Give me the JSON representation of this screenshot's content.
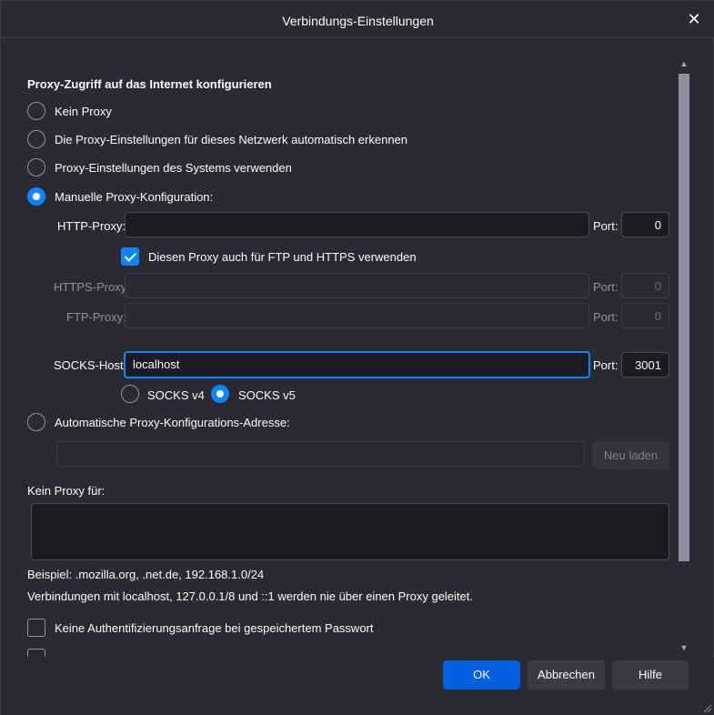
{
  "window": {
    "title": "Verbindungs-Einstellungen",
    "close": "✕"
  },
  "proxy": {
    "section_title": "Proxy-Zugriff auf das Internet konfigurieren",
    "options": {
      "no_proxy": "Kein Proxy",
      "auto_detect": "Die Proxy-Einstellungen für dieses Netzwerk automatisch erkennen",
      "system": "Proxy-Einstellungen des Systems verwenden",
      "manual": "Manuelle Proxy-Konfiguration:",
      "auto_config_url": "Automatische Proxy-Konfigurations-Adresse:"
    },
    "selected_option": "manual",
    "http": {
      "label": "HTTP-Proxy:",
      "value": "",
      "port_label": "Port:",
      "port": "0"
    },
    "share_checkbox": {
      "label": "Diesen Proxy auch für FTP und HTTPS verwenden",
      "checked": true
    },
    "https": {
      "label": "HTTPS-Proxy",
      "value": "",
      "port_label": "Port:",
      "port": "0"
    },
    "ftp": {
      "label": "FTP-Proxy:",
      "value": "",
      "port_label": "Port:",
      "port": "0"
    },
    "socks": {
      "label": "SOCKS-Host:",
      "value": "localhost",
      "port_label": "Port:",
      "port": "3001"
    },
    "socks_versions": {
      "v4": "SOCKS v4",
      "v5": "SOCKS v5",
      "selected": "v5"
    },
    "auto_config": {
      "value": "",
      "reload_button": "Neu laden"
    }
  },
  "no_proxy_for": {
    "label": "Kein Proxy für:",
    "value": "",
    "example": "Beispiel: .mozilla.org, .net.de, 192.168.1.0/24",
    "note": "Verbindungen mit localhost, 127.0.0.1/8 und ::1 werden nie über einen Proxy geleitet."
  },
  "options": {
    "no_auth_prompt": {
      "label": "Keine Authentifizierungsanfrage bei gespeichertem Passwort",
      "checked": false
    }
  },
  "footer": {
    "ok": "OK",
    "cancel": "Abbrechen",
    "help": "Hilfe"
  },
  "colors": {
    "background": "#2b2a33",
    "accent": "#0a84ff",
    "primary_button": "#0060df"
  }
}
